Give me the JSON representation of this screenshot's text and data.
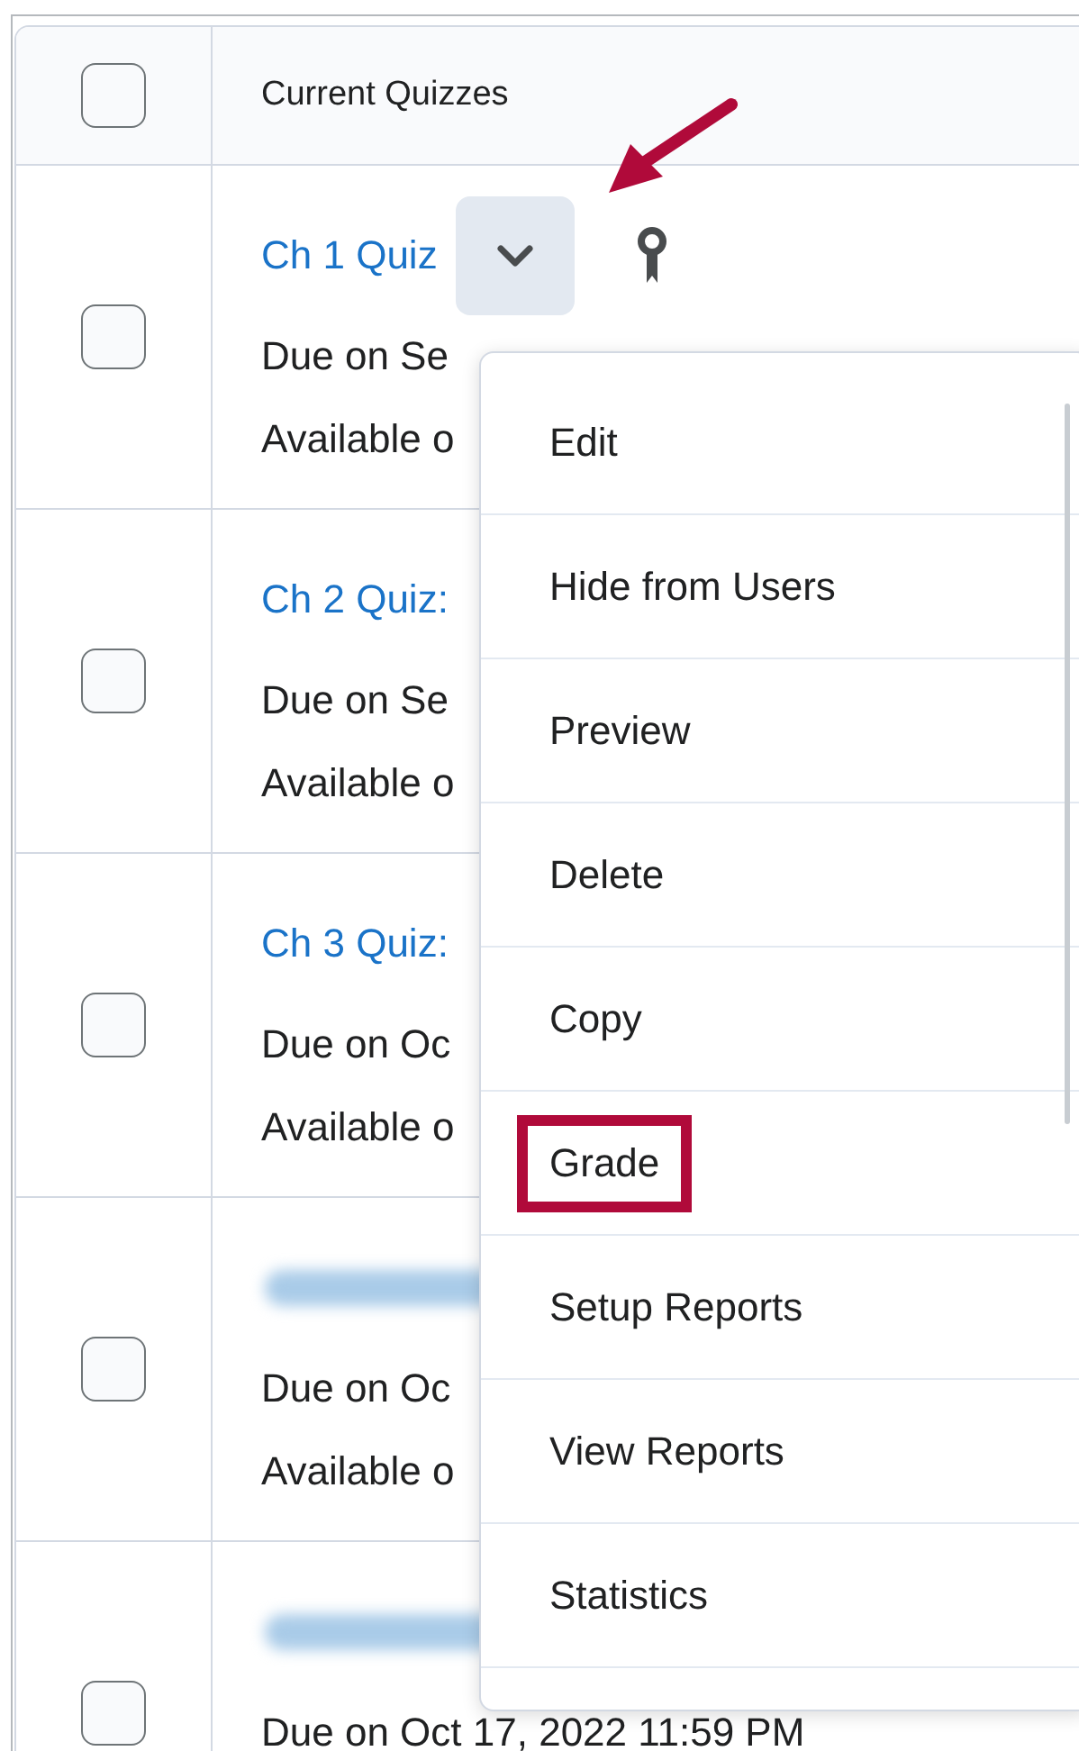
{
  "table": {
    "select_all": {
      "checked": false
    },
    "columns": [
      "Current Quizzes"
    ],
    "rows": [
      {
        "kind": "link",
        "title": "Ch 1 Quiz",
        "menu_button": true,
        "restricted": true,
        "due": "Due on Se",
        "available": "Available o",
        "checked": false
      },
      {
        "kind": "link",
        "title": "Ch 2 Quiz:",
        "menu_button": false,
        "restricted": false,
        "due": "Due on Se",
        "available": "Available o",
        "checked": false
      },
      {
        "kind": "link",
        "title": "Ch 3 Quiz:",
        "menu_button": false,
        "restricted": false,
        "due": "Due on Oc",
        "available": "Available o",
        "checked": false
      },
      {
        "kind": "blurred",
        "menu_button": false,
        "restricted": false,
        "due": "Due on Oc",
        "available": "Available o",
        "checked": false
      },
      {
        "kind": "blurred",
        "menu_button": false,
        "restricted": false,
        "due": "Due on Oct 17, 2022 11:59 PM",
        "checked": false
      }
    ]
  },
  "context_menu": {
    "items": [
      {
        "label": "Edit",
        "highlighted": false
      },
      {
        "label": "Hide from Users",
        "highlighted": false
      },
      {
        "label": "Preview",
        "highlighted": false
      },
      {
        "label": "Delete",
        "highlighted": false
      },
      {
        "label": "Copy",
        "highlighted": false
      },
      {
        "label": "Grade",
        "highlighted": true
      },
      {
        "label": "Setup Reports",
        "highlighted": false
      },
      {
        "label": "View Reports",
        "highlighted": false
      },
      {
        "label": "Statistics",
        "highlighted": false
      }
    ]
  },
  "annotation": {
    "arrow": true
  }
}
